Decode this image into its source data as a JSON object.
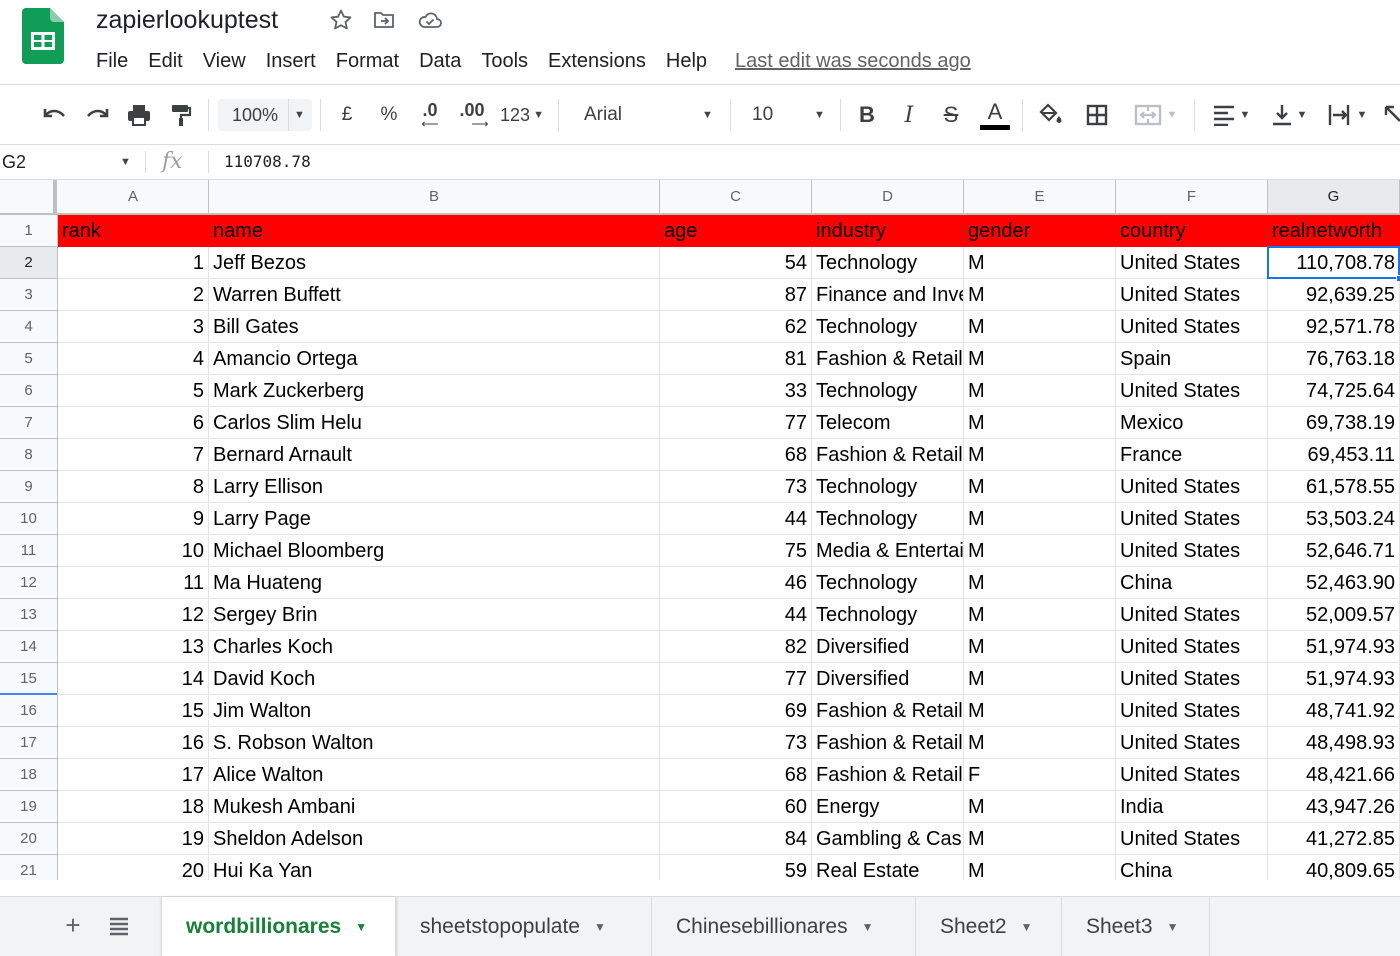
{
  "app": {
    "title": "zapierlookuptest",
    "last_edit": "Last edit was seconds ago",
    "brand_color": "#0f9d58"
  },
  "menu": [
    "File",
    "Edit",
    "View",
    "Insert",
    "Format",
    "Data",
    "Tools",
    "Extensions",
    "Help"
  ],
  "toolbar": {
    "zoom": "100%",
    "currency": "£",
    "percent": "%",
    "decrease_decimals": ".0",
    "increase_decimals": ".00",
    "more_formats": "123",
    "font": "Arial",
    "font_size": "10",
    "bold": "B",
    "italic": "I",
    "strike": "S",
    "text_color": "A"
  },
  "formula_bar": {
    "cell_ref": "G2",
    "fx": "fx",
    "value": "110708.78"
  },
  "grid": {
    "columns": [
      "A",
      "B",
      "C",
      "D",
      "E",
      "F",
      "G"
    ],
    "row_numbers": [
      "1",
      "2",
      "3",
      "4",
      "5",
      "6",
      "7",
      "8",
      "9",
      "10",
      "11",
      "12",
      "13",
      "14",
      "15",
      "16",
      "17",
      "18",
      "19",
      "20",
      "21"
    ],
    "header_fill": "#ff0000",
    "header": [
      "rank",
      "name",
      "age",
      "industry",
      "gender",
      "country",
      "realnetworth"
    ],
    "rows": [
      [
        "1",
        "Jeff Bezos",
        "54",
        "Technology",
        "M",
        "United States",
        "110,708.78"
      ],
      [
        "2",
        "Warren Buffett",
        "87",
        "Finance and Investments",
        "M",
        "United States",
        "92,639.25"
      ],
      [
        "3",
        "Bill Gates",
        "62",
        "Technology",
        "M",
        "United States",
        "92,571.78"
      ],
      [
        "4",
        "Amancio Ortega",
        "81",
        "Fashion & Retail",
        "M",
        "Spain",
        "76,763.18"
      ],
      [
        "5",
        "Mark Zuckerberg",
        "33",
        "Technology",
        "M",
        "United States",
        "74,725.64"
      ],
      [
        "6",
        "Carlos Slim Helu",
        "77",
        "Telecom",
        "M",
        "Mexico",
        "69,738.19"
      ],
      [
        "7",
        "Bernard Arnault",
        "68",
        "Fashion & Retail",
        "M",
        "France",
        "69,453.11"
      ],
      [
        "8",
        "Larry Ellison",
        "73",
        "Technology",
        "M",
        "United States",
        "61,578.55"
      ],
      [
        "9",
        "Larry Page",
        "44",
        "Technology",
        "M",
        "United States",
        "53,503.24"
      ],
      [
        "10",
        "Michael Bloomberg",
        "75",
        "Media & Entertainment",
        "M",
        "United States",
        "52,646.71"
      ],
      [
        "11",
        "Ma Huateng",
        "46",
        "Technology",
        "M",
        "China",
        "52,463.90"
      ],
      [
        "12",
        "Sergey Brin",
        "44",
        "Technology",
        "M",
        "United States",
        "52,009.57"
      ],
      [
        "13",
        "Charles Koch",
        "82",
        "Diversified",
        "M",
        "United States",
        "51,974.93"
      ],
      [
        "14",
        "David Koch",
        "77",
        "Diversified",
        "M",
        "United States",
        "51,974.93"
      ],
      [
        "15",
        "Jim Walton",
        "69",
        "Fashion & Retail",
        "M",
        "United States",
        "48,741.92"
      ],
      [
        "16",
        "S. Robson Walton",
        "73",
        "Fashion & Retail",
        "M",
        "United States",
        "48,498.93"
      ],
      [
        "17",
        "Alice Walton",
        "68",
        "Fashion & Retail",
        "F",
        "United States",
        "48,421.66"
      ],
      [
        "18",
        "Mukesh Ambani",
        "60",
        "Energy",
        "M",
        "India",
        "43,947.26"
      ],
      [
        "19",
        "Sheldon Adelson",
        "84",
        "Gambling & Casinos",
        "M",
        "United States",
        "41,272.85"
      ],
      [
        "20",
        "Hui Ka Yan",
        "59",
        "Real Estate",
        "M",
        "China",
        "40,809.65"
      ]
    ]
  },
  "sheets": [
    {
      "label": "wordbillionares",
      "active": true
    },
    {
      "label": "sheetstopopulate",
      "active": false
    },
    {
      "label": "Chinesebillionares",
      "active": false
    },
    {
      "label": "Sheet2",
      "active": false
    },
    {
      "label": "Sheet3",
      "active": false
    }
  ],
  "sheet_controls": {
    "add": "+"
  }
}
